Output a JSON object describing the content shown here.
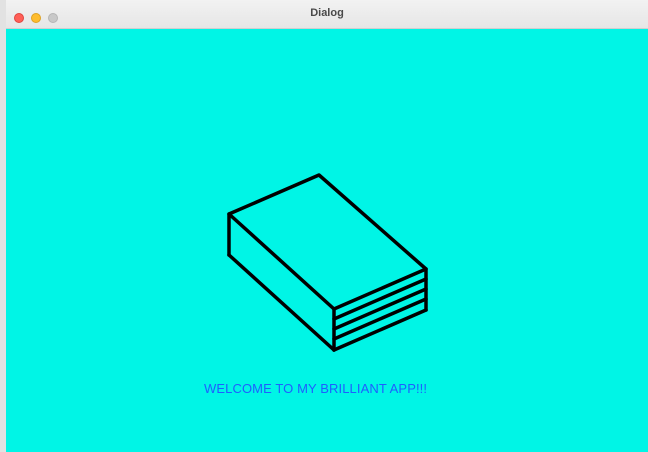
{
  "window": {
    "title": "Dialog",
    "controls": [
      "close",
      "minimize",
      "maximize"
    ]
  },
  "content": {
    "background_color": "#00f5e6",
    "icon": "book-icon",
    "welcome_text": "WELCOME TO MY BRILLIANT APP!!!",
    "welcome_color": "#1f5eff"
  }
}
